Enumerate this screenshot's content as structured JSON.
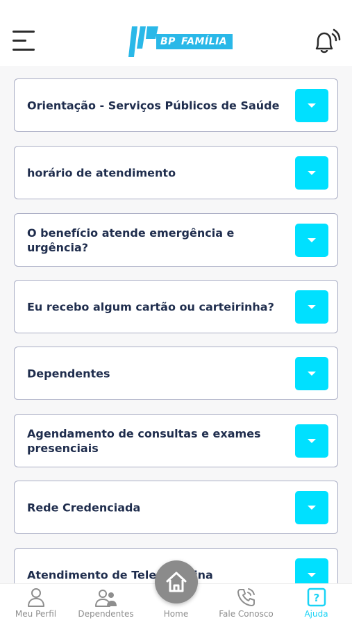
{
  "header": {
    "brand_bp": "BP",
    "brand_familia": "FAMÍLIA",
    "menu_icon": "hamburger-menu-icon",
    "notification_icon": "bell-ringing-icon"
  },
  "faq": {
    "items": [
      {
        "question": "Orientação - Serviços Públicos de Saúde"
      },
      {
        "question": "horário de atendimento"
      },
      {
        "question": "O benefício atende emergência e urgência?"
      },
      {
        "question": "Eu recebo algum cartão ou carteirinha?"
      },
      {
        "question": "Dependentes"
      },
      {
        "question": "Agendamento de consultas e exames presenciais"
      },
      {
        "question": "Rede Credenciada"
      },
      {
        "question": "Atendimento de Telemedicina"
      }
    ],
    "expand_icon": "caret-down-icon"
  },
  "nav": {
    "meu_perfil": "Meu Perfil",
    "dependentes": "Dependentes",
    "home": "Home",
    "fale_conosco": "Fale Conosco",
    "ajuda": "Ajuda",
    "active": "ajuda"
  },
  "colors": {
    "accent": "#00e0ff",
    "active_nav": "#19d3f5",
    "brand": "#2ab8e8",
    "text_dark": "#1f2d4d",
    "home_fab": "#8b8b8b"
  }
}
